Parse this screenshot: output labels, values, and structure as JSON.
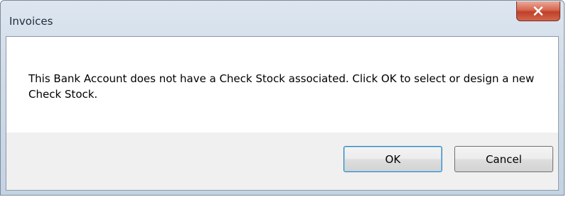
{
  "window": {
    "title": "Invoices",
    "close_icon": "close-icon"
  },
  "message": {
    "text": "This Bank Account does not have a Check Stock associated.  Click OK to select or design a new Check Stock."
  },
  "buttons": {
    "ok_label": "OK",
    "cancel_label": "Cancel"
  },
  "colors": {
    "close_button": "#c94a33",
    "ok_focus_border": "#3c7fb1",
    "button_bar": "#f0f0f0"
  }
}
